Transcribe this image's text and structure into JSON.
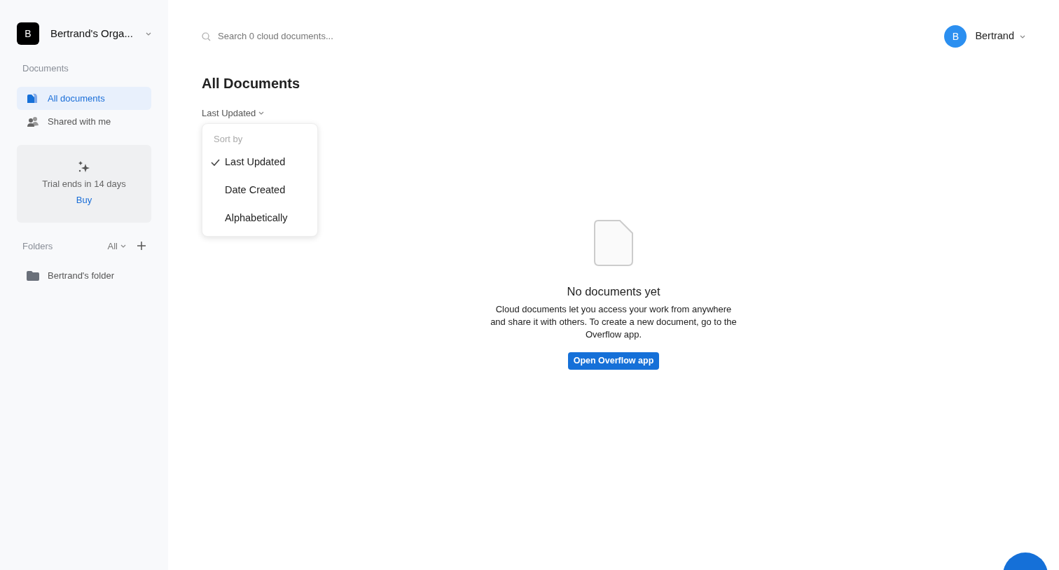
{
  "org": {
    "initial": "B",
    "name": "Bertrand's Orga..."
  },
  "sidebar": {
    "section_title": "Documents",
    "items": [
      {
        "label": "All documents",
        "kind": "documents",
        "selected": true
      },
      {
        "label": "Shared with me",
        "kind": "shared",
        "selected": false
      }
    ],
    "trial": {
      "text": "Trial ends in 14 days",
      "link": "Buy"
    },
    "folders_title": "Folders",
    "folders_filter": "All",
    "folders": [
      {
        "label": "Bertrand's folder"
      }
    ]
  },
  "search": {
    "placeholder": "Search 0 cloud documents..."
  },
  "user": {
    "initial": "B",
    "name": "Bertrand"
  },
  "heading": "All Documents",
  "sort": {
    "label": "Last Updated",
    "expanded": true,
    "menu_title": "Sort by",
    "options": [
      {
        "label": "Last Updated",
        "selected": true
      },
      {
        "label": "Date Created",
        "selected": false
      },
      {
        "label": "Alphabetically",
        "selected": false
      }
    ]
  },
  "empty": {
    "title": "No documents yet",
    "text": "Cloud documents let you access your work from anywhere and share it with others. To create a new document, go to the Overflow app.",
    "button": "Open Overflow app"
  }
}
